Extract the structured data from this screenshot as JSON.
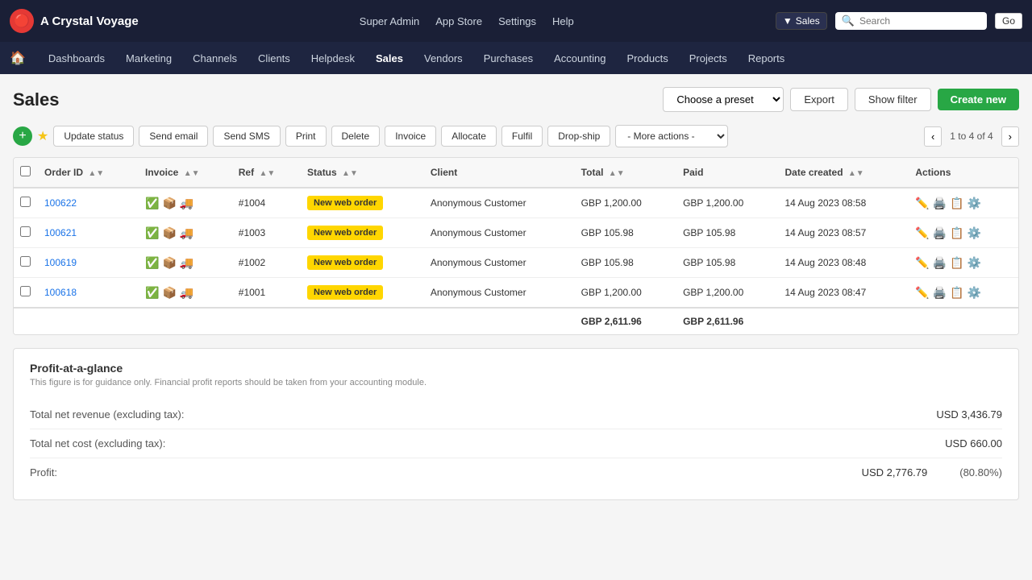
{
  "app": {
    "name": "A Crystal Voyage",
    "logo_char": "🔴"
  },
  "topnav": {
    "links": [
      "Super Admin",
      "App Store",
      "Settings",
      "Help"
    ],
    "db_selector": "Sales",
    "search_placeholder": "Search",
    "go_label": "Go"
  },
  "secondnav": {
    "links": [
      "Dashboards",
      "Marketing",
      "Channels",
      "Clients",
      "Helpdesk",
      "Sales",
      "Vendors",
      "Purchases",
      "Accounting",
      "Products",
      "Projects",
      "Reports"
    ],
    "active": "Sales"
  },
  "page": {
    "title": "Sales"
  },
  "header_actions": {
    "preset_placeholder": "Choose a preset",
    "export_label": "Export",
    "show_filter_label": "Show filter",
    "create_new_label": "Create new"
  },
  "toolbar": {
    "update_status": "Update status",
    "send_email": "Send email",
    "send_sms": "Send SMS",
    "print": "Print",
    "delete": "Delete",
    "invoice": "Invoice",
    "allocate": "Allocate",
    "fulfil": "Fulfil",
    "drop_ship": "Drop-ship",
    "more_actions": "- More actions -",
    "pagination_info": "1 to 4 of 4"
  },
  "table": {
    "columns": [
      "Order ID",
      "Invoice",
      "Ref",
      "Status",
      "Client",
      "Total",
      "Paid",
      "Date created",
      "Actions"
    ],
    "rows": [
      {
        "id": "100622",
        "ref": "#1004",
        "status": "New web order",
        "client": "Anonymous Customer",
        "total": "GBP 1,200.00",
        "paid": "GBP 1,200.00",
        "date": "14 Aug 2023 08:58"
      },
      {
        "id": "100621",
        "ref": "#1003",
        "status": "New web order",
        "client": "Anonymous Customer",
        "total": "GBP 105.98",
        "paid": "GBP 105.98",
        "date": "14 Aug 2023 08:57"
      },
      {
        "id": "100619",
        "ref": "#1002",
        "status": "New web order",
        "client": "Anonymous Customer",
        "total": "GBP 105.98",
        "paid": "GBP 105.98",
        "date": "14 Aug 2023 08:48"
      },
      {
        "id": "100618",
        "ref": "#1001",
        "status": "New web order",
        "client": "Anonymous Customer",
        "total": "GBP 1,200.00",
        "paid": "GBP 1,200.00",
        "date": "14 Aug 2023 08:47"
      }
    ],
    "total_total": "GBP 2,611.96",
    "total_paid": "GBP 2,611.96"
  },
  "profit": {
    "title": "Profit-at-a-glance",
    "subtitle": "This figure is for guidance only. Financial profit reports should be taken from your accounting module.",
    "revenue_label": "Total net revenue (excluding tax):",
    "revenue_value": "USD 3,436.79",
    "cost_label": "Total net cost (excluding tax):",
    "cost_value": "USD 660.00",
    "profit_label": "Profit:",
    "profit_value": "USD 2,776.79",
    "profit_pct": "(80.80%)"
  }
}
